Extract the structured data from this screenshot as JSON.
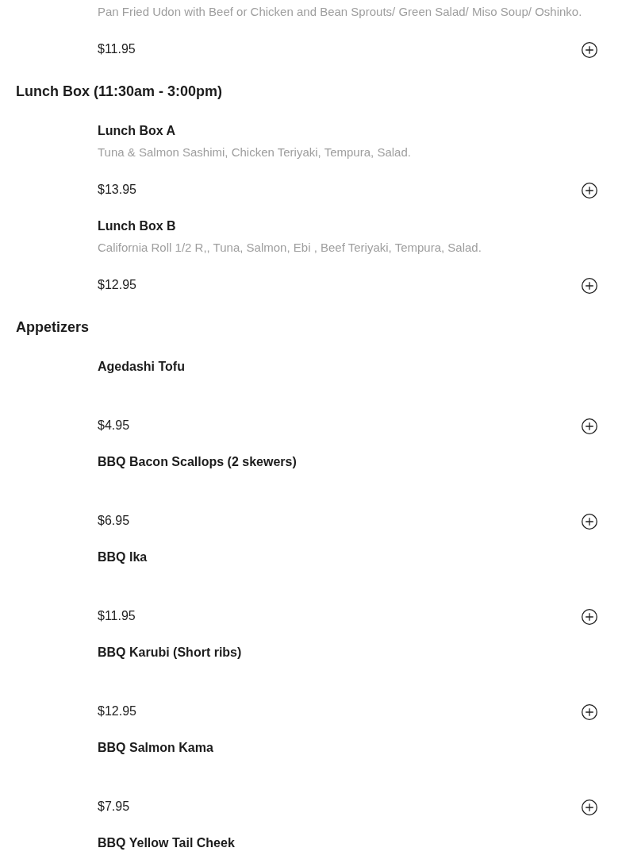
{
  "sections": [
    {
      "items": [
        {
          "description": "Pan Fried Udon with Beef or Chicken and Bean Sprouts/ Green Salad/ Miso Soup/ Oshinko.",
          "price": "$11.95"
        }
      ]
    },
    {
      "title": "Lunch Box (11:30am - 3:00pm)",
      "items": [
        {
          "name": "Lunch Box A",
          "description": "Tuna & Salmon Sashimi, Chicken Teriyaki, Tempura, Salad.",
          "price": "$13.95"
        },
        {
          "name": "Lunch Box B",
          "description": "California Roll 1/2 R,, Tuna, Salmon, Ebi , Beef Teriyaki, Tempura, Salad.",
          "price": "$12.95"
        }
      ]
    },
    {
      "title": "Appetizers",
      "items": [
        {
          "name": "Agedashi Tofu",
          "price": "$4.95"
        },
        {
          "name": "BBQ Bacon Scallops (2 skewers)",
          "price": "$6.95"
        },
        {
          "name": "BBQ Ika",
          "price": "$11.95"
        },
        {
          "name": "BBQ Karubi (Short ribs)",
          "price": "$12.95"
        },
        {
          "name": "BBQ Salmon Kama",
          "price": "$7.95"
        },
        {
          "name": "BBQ Yellow Tail Cheek"
        }
      ]
    }
  ]
}
